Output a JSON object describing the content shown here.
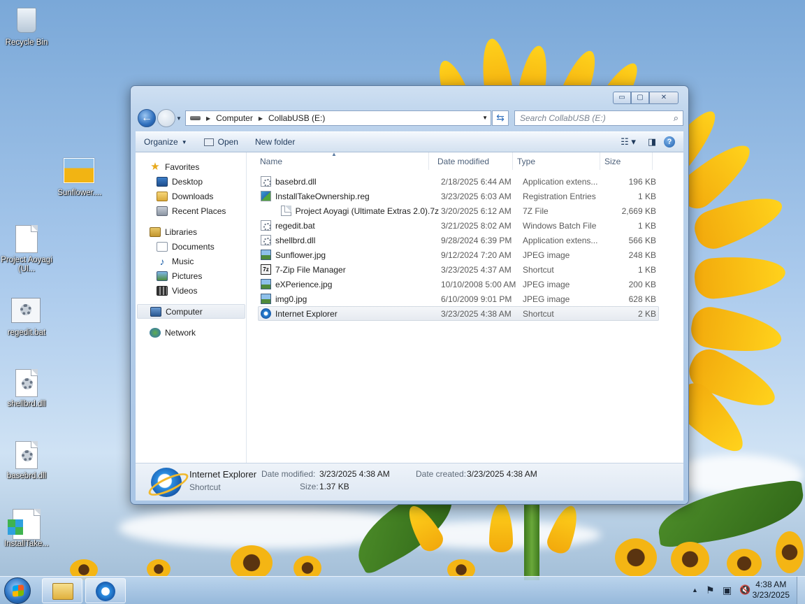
{
  "desktop": {
    "icons": [
      {
        "label": "Recycle Bin",
        "icon": "recycle-bin-icon"
      },
      {
        "label": "Sunflower....",
        "icon": "image-icon"
      },
      {
        "label": "Project Aoyagi (Ul...",
        "icon": "document-icon"
      },
      {
        "label": "regedit.bat",
        "icon": "batch-file-icon"
      },
      {
        "label": "shellbrd.dll",
        "icon": "dll-file-icon"
      },
      {
        "label": "basebrd.dll",
        "icon": "dll-file-icon"
      },
      {
        "label": "InstallTake...",
        "icon": "registry-file-icon"
      }
    ]
  },
  "window": {
    "caption_buttons": {
      "minimize": "▭",
      "maximize": "▢",
      "close": "✕"
    },
    "address": {
      "crumbs": [
        "Computer",
        "CollabUSB (E:)"
      ]
    },
    "search": {
      "placeholder": "Search CollabUSB (E:)"
    },
    "toolbar": {
      "organize": "Organize",
      "open": "Open",
      "new_folder": "New folder"
    },
    "nav": {
      "favorites": "Favorites",
      "favorites_items": [
        "Desktop",
        "Downloads",
        "Recent Places"
      ],
      "libraries": "Libraries",
      "libraries_items": [
        "Documents",
        "Music",
        "Pictures",
        "Videos"
      ],
      "computer": "Computer",
      "network": "Network"
    },
    "columns": {
      "name": "Name",
      "date": "Date modified",
      "type": "Type",
      "size": "Size"
    },
    "files": [
      {
        "name": "basebrd.dll",
        "date": "2/18/2025 6:44 AM",
        "type": "Application extens...",
        "size": "196 KB",
        "icon": "cfg"
      },
      {
        "name": "InstallTakeOwnership.reg",
        "date": "3/23/2025 6:03 AM",
        "type": "Registration Entries",
        "size": "1 KB",
        "icon": "reg"
      },
      {
        "name": "Project Aoyagi (Ultimate Extras 2.0).7z",
        "date": "3/20/2025 6:12 AM",
        "type": "7Z File",
        "size": "2,669 KB",
        "icon": "doc"
      },
      {
        "name": "regedit.bat",
        "date": "3/21/2025 8:02 AM",
        "type": "Windows Batch File",
        "size": "1 KB",
        "icon": "cfg"
      },
      {
        "name": "shellbrd.dll",
        "date": "9/28/2024 6:39 PM",
        "type": "Application extens...",
        "size": "566 KB",
        "icon": "cfg"
      },
      {
        "name": "Sunflower.jpg",
        "date": "9/12/2024 7:20 AM",
        "type": "JPEG image",
        "size": "248 KB",
        "icon": "img"
      },
      {
        "name": "7-Zip File Manager",
        "date": "3/23/2025 4:37 AM",
        "type": "Shortcut",
        "size": "1 KB",
        "icon": "zip"
      },
      {
        "name": "eXPerience.jpg",
        "date": "10/10/2008 5:00 AM",
        "type": "JPEG image",
        "size": "200 KB",
        "icon": "img"
      },
      {
        "name": "img0.jpg",
        "date": "6/10/2009 9:01 PM",
        "type": "JPEG image",
        "size": "628 KB",
        "icon": "img"
      },
      {
        "name": "Internet Explorer",
        "date": "3/23/2025 4:38 AM",
        "type": "Shortcut",
        "size": "2 KB",
        "icon": "ie"
      }
    ],
    "details": {
      "name": "Internet Explorer",
      "kind": "Shortcut",
      "modified_label": "Date modified:",
      "modified_value": "3/23/2025 4:38 AM",
      "created_label": "Date created:",
      "created_value": "3/23/2025 4:38 AM",
      "size_label": "Size:",
      "size_value": "1.37 KB"
    }
  },
  "taskbar": {
    "clock_time": "4:38 AM",
    "clock_date": "3/23/2025",
    "tray_icons": {
      "expand": "▲",
      "flag": "⚑",
      "network": "▣",
      "volume": "🔇"
    }
  }
}
